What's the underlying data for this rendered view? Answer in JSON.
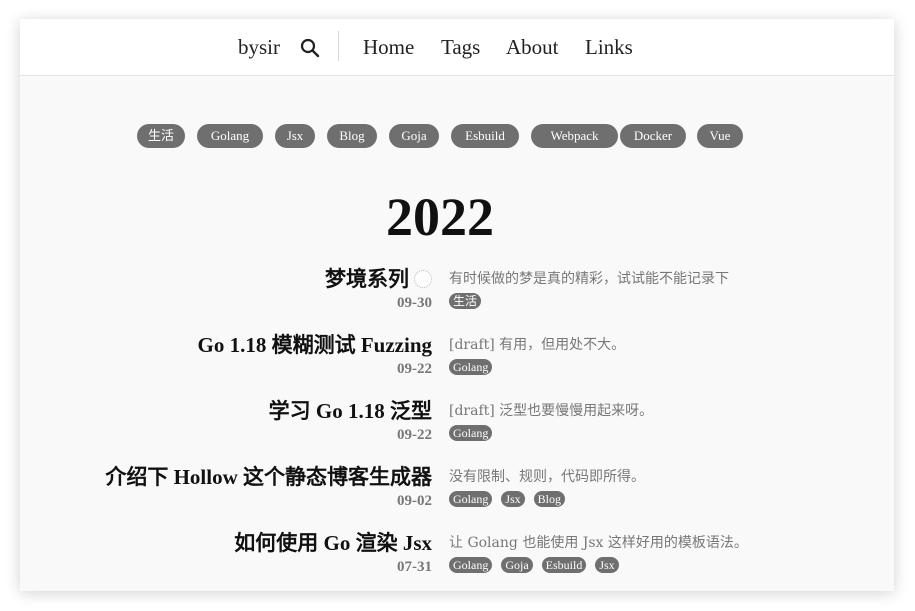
{
  "header": {
    "brand": "bysir",
    "nav": [
      "Home",
      "Tags",
      "About",
      "Links"
    ]
  },
  "tags": [
    "生活",
    "Golang",
    "Jsx",
    "Blog",
    "Goja",
    "Esbuild",
    "Webpack",
    "Docker",
    "Vue"
  ],
  "year": "2022",
  "posts": [
    {
      "title": "梦境系列",
      "date": "09-30",
      "desc": "有时候做的梦是真的精彩，试试能不能记录下",
      "tags": [
        "生活"
      ]
    },
    {
      "title": "Go 1.18 模糊测试 Fuzzing",
      "date": "09-22",
      "desc": "[draft] 有用，但用处不大。",
      "tags": [
        "Golang"
      ]
    },
    {
      "title": "学习 Go 1.18 泛型",
      "date": "09-22",
      "desc": "[draft] 泛型也要慢慢用起来呀。",
      "tags": [
        "Golang"
      ]
    },
    {
      "title": "介绍下 Hollow 这个静态博客生成器",
      "date": "09-02",
      "desc": "没有限制、规则，代码即所得。",
      "tags": [
        "Golang",
        "Jsx",
        "Blog"
      ]
    },
    {
      "title": "如何使用 Go 渲染 Jsx",
      "date": "07-31",
      "desc": "让 Golang 也能使用 Jsx 这样好用的模板语法。",
      "tags": [
        "Golang",
        "Goja",
        "Esbuild",
        "Jsx"
      ]
    }
  ]
}
